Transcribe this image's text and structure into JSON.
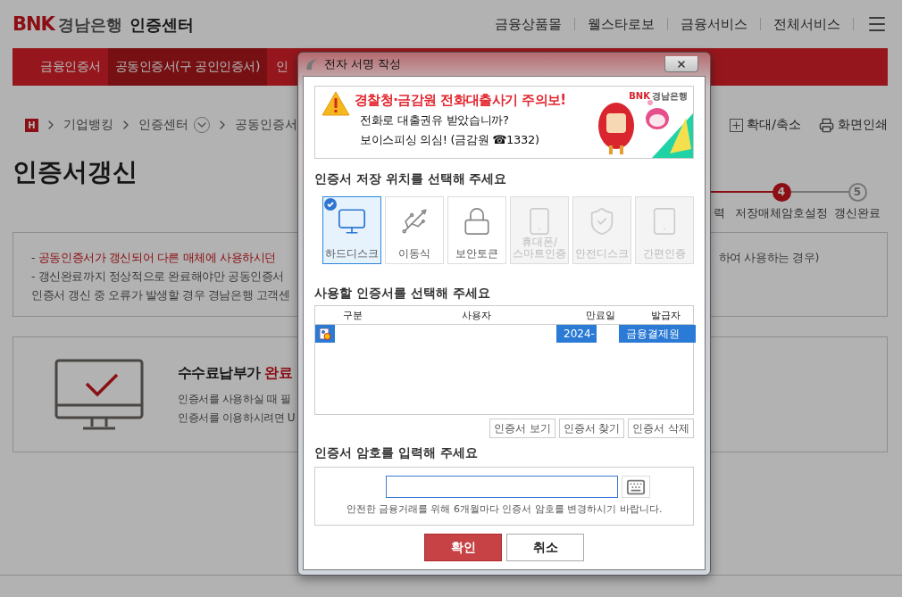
{
  "header": {
    "logo": {
      "brand": "BNK",
      "bank": "경남은행",
      "site": "인증센터"
    },
    "links": [
      "금융상품몰",
      "웰스타로보",
      "금융서비스",
      "전체서비스"
    ]
  },
  "nav": [
    {
      "label": "금융인증서",
      "selected": false
    },
    {
      "label": "공동인증서(구 공인인증서)",
      "selected": true
    },
    {
      "label": "인",
      "selected": false
    }
  ],
  "breadcrumb": {
    "home": "H",
    "items": [
      "기업뱅킹",
      "인증센터",
      "공동인증서"
    ]
  },
  "tools": [
    "확대/축소",
    "화면인쇄"
  ],
  "page_title": "인증서갱신",
  "steps": [
    {
      "label": "력"
    },
    {
      "number": "4",
      "label": "저장매체암호설정",
      "done": true
    },
    {
      "number": "5",
      "label": "갱신완료",
      "done": false
    }
  ],
  "notice": {
    "line1_dash": "-",
    "line1_left": "공동인증서가 갱신되어 다른 매체에 사용하시던",
    "line1_right": "하여 사용하는 경우)",
    "line2": "- 갱신완료까지 정상적으로 완료해야만 공동인증서",
    "line3": "인증서 갱신 중 오류가 발생할 경우 경남은행 고객센"
  },
  "completion": {
    "title": "수수료납부가 **완료**",
    "lines": [
      "인증서를 사용하실 때 필",
      "인증서를 이용하시려면 U"
    ]
  },
  "dialog": {
    "title": "전자 서명 작성",
    "banner": {
      "headline": "경찰청·금감원 전화대출사기 주의보!",
      "line1": "전화로 대출권유 받았습니까?",
      "line2": "보이스피싱 의심! (금감원 ☎1332)",
      "logo_brand": "BNK",
      "logo_bank": "경남은행"
    },
    "media_heading": "인증서 저장 위치를 선택해 주세요",
    "media": [
      {
        "kind": "harddisk",
        "label": "하드디스크",
        "selected": true,
        "disabled": false
      },
      {
        "kind": "removable",
        "label": "이동식",
        "selected": false,
        "disabled": false
      },
      {
        "kind": "token",
        "label": "보안토큰",
        "selected": false,
        "disabled": false
      },
      {
        "kind": "phone",
        "label": "휴대폰/\n스마트인증",
        "selected": false,
        "disabled": true
      },
      {
        "kind": "safedisk",
        "label": "안전디스크",
        "selected": false,
        "disabled": true
      },
      {
        "kind": "simple",
        "label": "간편인증",
        "selected": false,
        "disabled": true
      }
    ],
    "cert_heading": "사용할 인증서를 선택해 주세요",
    "columns": [
      "구분",
      "사용자",
      "만료일",
      "발급자"
    ],
    "rows": [
      {
        "expiry": "2024-",
        "issuer": "금융결제원",
        "selected": true
      }
    ],
    "cert_buttons": [
      "인증서 보기",
      "인증서 찾기",
      "인증서 삭제"
    ],
    "password_heading": "인증서 암호를 입력해 주세요",
    "password_hint": "안전한 금융거래를 위해 6개월마다 인증서 암호를 변경하시기 바랍니다.",
    "buttons": [
      {
        "label": "확인",
        "kind": "primary"
      },
      {
        "label": "취소",
        "kind": "secondary"
      }
    ]
  }
}
